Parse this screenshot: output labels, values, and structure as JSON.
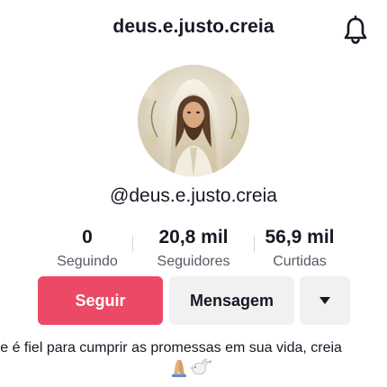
{
  "header": {
    "title": "deus.e.justo.creia",
    "notification_icon": "bell-icon"
  },
  "profile": {
    "avatar_icon": "profile-avatar-image",
    "handle": "@deus.e.justo.creia"
  },
  "stats": [
    {
      "value": "0",
      "label": "Seguindo"
    },
    {
      "value": "20,8 mil",
      "label": "Seguidores"
    },
    {
      "value": "56,9 mil",
      "label": "Curtidas"
    }
  ],
  "actions": {
    "follow_label": "Seguir",
    "message_label": "Mensagem",
    "more_icon": "caret-down-icon"
  },
  "bio": {
    "text": "Ele é fiel para cumprir as promessas em sua vida, creia",
    "emojis": [
      "praying-hands-emoji",
      "dove-emoji"
    ]
  },
  "colors": {
    "follow_button": "#ec4966",
    "secondary_button": "#f1f1f2",
    "text_primary": "#161823",
    "text_secondary": "#555a63"
  }
}
